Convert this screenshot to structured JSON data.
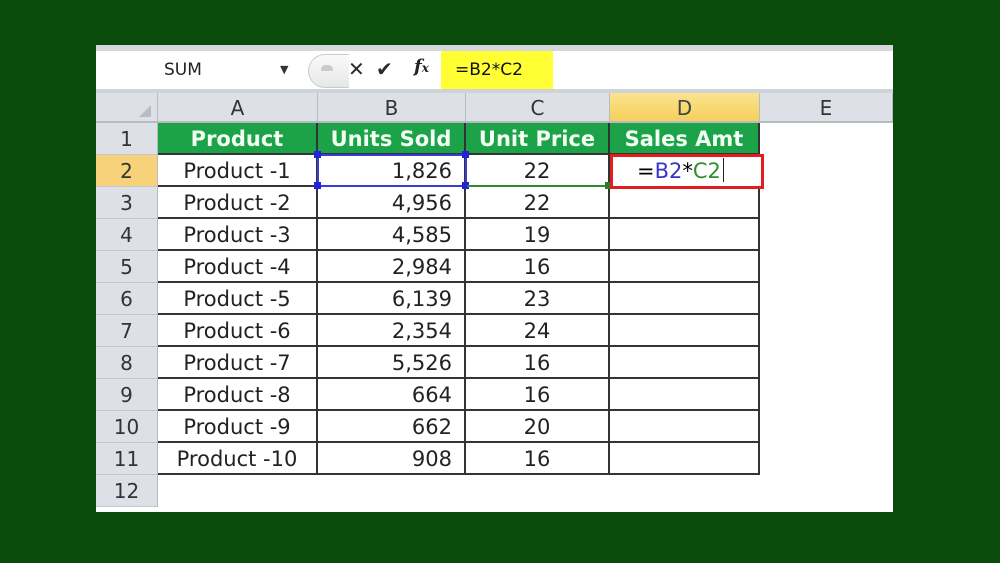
{
  "formula_bar": {
    "name_box": "SUM",
    "cancel_icon": "✕",
    "enter_icon": "✔",
    "fx_label": "f",
    "fx_sub": "x",
    "formula": "=B2*C2",
    "highlight_color": "#ffff33"
  },
  "columns": [
    "A",
    "B",
    "C",
    "D",
    "E"
  ],
  "active_column": "D",
  "row_numbers": [
    "1",
    "2",
    "3",
    "4",
    "5",
    "6",
    "7",
    "8",
    "9",
    "10",
    "11",
    "12"
  ],
  "active_row": "2",
  "table": {
    "headers": [
      "Product",
      "Units Sold",
      "Unit Price",
      "Sales Amt"
    ],
    "header_color": "#1ca34a",
    "rows": [
      {
        "product": "Product -1",
        "units": "1,826",
        "price": "22"
      },
      {
        "product": "Product -2",
        "units": "4,956",
        "price": "22"
      },
      {
        "product": "Product -3",
        "units": "4,585",
        "price": "19"
      },
      {
        "product": "Product -4",
        "units": "2,984",
        "price": "16"
      },
      {
        "product": "Product -5",
        "units": "6,139",
        "price": "23"
      },
      {
        "product": "Product -6",
        "units": "2,354",
        "price": "24"
      },
      {
        "product": "Product -7",
        "units": "5,526",
        "price": "16"
      },
      {
        "product": "Product -8",
        "units": "664",
        "price": "16"
      },
      {
        "product": "Product -9",
        "units": "662",
        "price": "20"
      },
      {
        "product": "Product -10",
        "units": "908",
        "price": "16"
      }
    ]
  },
  "editing_cell": {
    "address": "D2",
    "prefix": "=",
    "ref1": "B2",
    "op": "*",
    "ref2": "C2",
    "ref1_color": "#3535c8",
    "ref2_color": "#2f8f2f",
    "highlight_border": "#e21d1d"
  }
}
